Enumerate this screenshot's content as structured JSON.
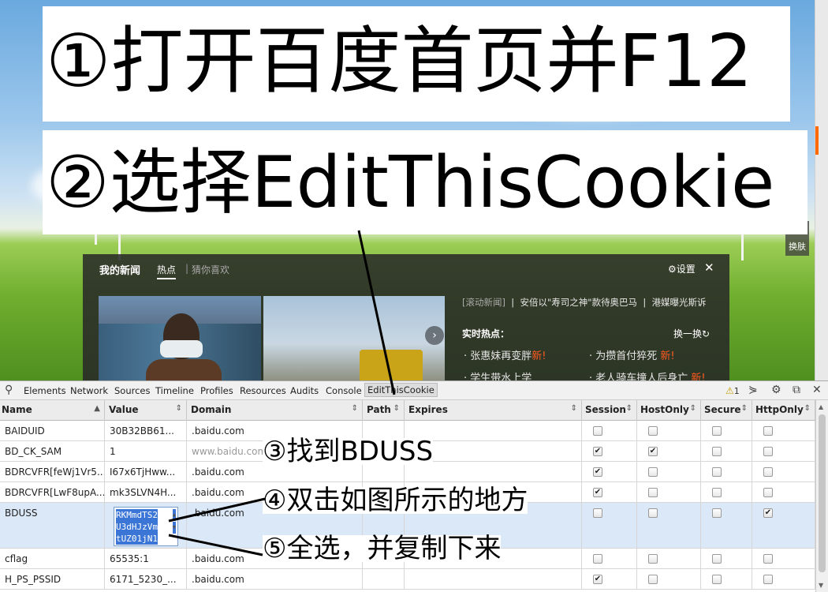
{
  "annotations": {
    "step1": "①打开百度首页并F12",
    "step2": "②选择EditThisCookie",
    "step3": "③找到BDUSS",
    "step4": "④双击如图所示的地方",
    "step5": "⑤全选，并复制下来"
  },
  "page": {
    "swap_label": "换肤"
  },
  "news_panel": {
    "title": "我的新闻",
    "tab_hot": "热点",
    "separator": "|",
    "tab_guess": "猜你喜欢",
    "settings_label": "设置",
    "rolling_label": "[滚动新闻]",
    "headline_1": "安倍以\"寿司之神\"款待奥巴马",
    "headline_2": "港媒曝光斯诉",
    "hot_title": "实时热点：",
    "refresh_label": "换一换",
    "hot_items": [
      {
        "text": "张惠妹再变胖",
        "badge": "新!"
      },
      {
        "text": "为攒首付猝死",
        "badge": "新!"
      },
      {
        "text": "学生带水上学",
        "badge": ""
      },
      {
        "text": "老人骑车撞人后身亡",
        "badge": "新!"
      }
    ]
  },
  "devtools": {
    "tabs": [
      "Elements",
      "Network",
      "Sources",
      "Timeline",
      "Profiles",
      "Resources",
      "Audits",
      "Console",
      "EditThisCookie"
    ],
    "active_tab": "EditThisCookie",
    "warning_count": "1"
  },
  "cookie_table": {
    "columns": [
      "Name",
      "Value",
      "Domain",
      "Path",
      "Expires",
      "Session",
      "HostOnly",
      "Secure",
      "HttpOnly"
    ],
    "rows": [
      {
        "name": "BAIDUID",
        "value": "30B32BB61...",
        "domain": ".baidu.com",
        "session": false,
        "hostonly": false,
        "secure": false,
        "httponly": false
      },
      {
        "name": "BD_CK_SAM",
        "value": "1",
        "domain": "www.baidu.com",
        "session": true,
        "hostonly": true,
        "secure": false,
        "httponly": false
      },
      {
        "name": "BDRCVFR[feWj1Vr5...",
        "value": "I67x6TjHww...",
        "domain": ".baidu.com",
        "session": true,
        "hostonly": false,
        "secure": false,
        "httponly": false
      },
      {
        "name": "BDRCVFR[LwF8upA...",
        "value": "mk3SLVN4H...",
        "domain": ".baidu.com",
        "session": true,
        "hostonly": false,
        "secure": false,
        "httponly": false
      },
      {
        "name": "BDUSS",
        "value": "",
        "domain": ".baidu.com",
        "session": false,
        "hostonly": false,
        "secure": false,
        "httponly": true
      },
      {
        "name": "cflag",
        "value": "65535:1",
        "domain": ".baidu.com",
        "session": false,
        "hostonly": false,
        "secure": false,
        "httponly": false
      },
      {
        "name": "H_PS_PSSID",
        "value": "6171_5230_...",
        "domain": ".baidu.com",
        "session": true,
        "hostonly": false,
        "secure": false,
        "httponly": false
      }
    ],
    "edit_value_lines": [
      "RKMmdTS2",
      "U3dHJzVm",
      "tUZ01jN1"
    ]
  }
}
